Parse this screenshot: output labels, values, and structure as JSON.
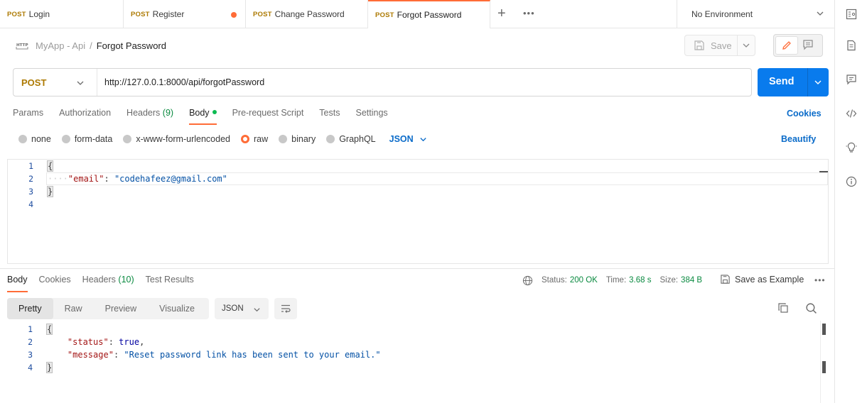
{
  "tabs": [
    {
      "method": "POST",
      "label": "Login"
    },
    {
      "method": "POST",
      "label": "Register"
    },
    {
      "method": "POST",
      "label": "Change Password"
    },
    {
      "method": "POST",
      "label": "Forgot Password"
    }
  ],
  "environment": "No Environment",
  "breadcrumb": {
    "parent": "MyApp - Api",
    "separator": "/",
    "current": "Forgot Password"
  },
  "save_label": "Save",
  "request": {
    "method": "POST",
    "url": "http://127.0.0.1:8000/api/forgotPassword",
    "send_label": "Send"
  },
  "request_tabs": {
    "params": "Params",
    "authorization": "Authorization",
    "headers": "Headers",
    "headers_count": "(9)",
    "body": "Body",
    "prerequest": "Pre-request Script",
    "tests": "Tests",
    "settings": "Settings",
    "cookies_link": "Cookies"
  },
  "body_modes": {
    "none": "none",
    "form_data": "form-data",
    "urlencoded": "x-www-form-urlencoded",
    "raw": "raw",
    "binary": "binary",
    "graphql": "GraphQL",
    "language": "JSON",
    "beautify": "Beautify"
  },
  "request_body": {
    "line_numbers": [
      "1",
      "2",
      "3",
      "4"
    ],
    "open_brace": "{",
    "key": "\"email\"",
    "colon": ": ",
    "value": "\"codehafeez@gmail.com\"",
    "close_brace": "}"
  },
  "response_tabs": {
    "body": "Body",
    "cookies": "Cookies",
    "headers": "Headers",
    "headers_count": "(10)",
    "test_results": "Test Results"
  },
  "response_status": {
    "status_label": "Status:",
    "status_value": "200 OK",
    "time_label": "Time:",
    "time_value": "3.68 s",
    "size_label": "Size:",
    "size_value": "384 B",
    "save_example": "Save as Example"
  },
  "response_formats": {
    "pretty": "Pretty",
    "raw": "Raw",
    "preview": "Preview",
    "visualize": "Visualize",
    "language": "JSON"
  },
  "response_body": {
    "line_numbers": [
      "1",
      "2",
      "3",
      "4"
    ],
    "open_brace": "{",
    "status_key": "\"status\"",
    "status_value": "true",
    "message_key": "\"message\"",
    "message_value": "\"Reset password link has been sent to your email.\"",
    "close_brace": "}"
  }
}
